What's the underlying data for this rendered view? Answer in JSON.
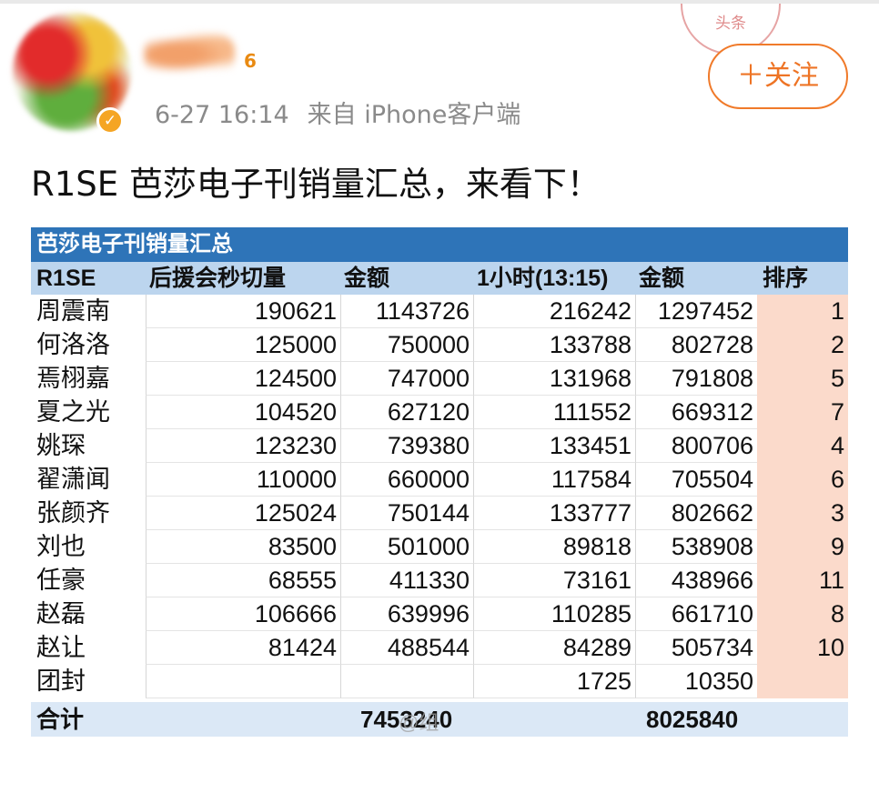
{
  "post": {
    "time": "6-27 16:14",
    "source": "来自 iPhone客户端",
    "follow_label": "＋关注",
    "badge_icon": "verified-badge-icon",
    "level_icon": "level-6-icon",
    "level_text": "6",
    "stamp_text": "头条",
    "text": "R1SE 芭莎电子刊销量汇总，来看下！"
  },
  "sheet": {
    "title": "芭莎电子刊销量汇总",
    "headers": [
      "R1SE",
      "后援会秒切量",
      "金额",
      "1小时(13:15)",
      "金额",
      "排序"
    ],
    "rows": [
      {
        "name": "周震南",
        "v1": "190621",
        "v2": "1143726",
        "v3": "216242",
        "v4": "1297452",
        "rank": "1"
      },
      {
        "name": "何洛洛",
        "v1": "125000",
        "v2": "750000",
        "v3": "133788",
        "v4": "802728",
        "rank": "2"
      },
      {
        "name": "焉栩嘉",
        "v1": "124500",
        "v2": "747000",
        "v3": "131968",
        "v4": "791808",
        "rank": "5"
      },
      {
        "name": "夏之光",
        "v1": "104520",
        "v2": "627120",
        "v3": "111552",
        "v4": "669312",
        "rank": "7"
      },
      {
        "name": "姚琛",
        "v1": "123230",
        "v2": "739380",
        "v3": "133451",
        "v4": "800706",
        "rank": "4"
      },
      {
        "name": "翟潇闻",
        "v1": "110000",
        "v2": "660000",
        "v3": "117584",
        "v4": "705504",
        "rank": "6"
      },
      {
        "name": "张颜齐",
        "v1": "125024",
        "v2": "750144",
        "v3": "133777",
        "v4": "802662",
        "rank": "3"
      },
      {
        "name": "刘也",
        "v1": "83500",
        "v2": "501000",
        "v3": "89818",
        "v4": "538908",
        "rank": "9"
      },
      {
        "name": "任豪",
        "v1": "68555",
        "v2": "411330",
        "v3": "73161",
        "v4": "438966",
        "rank": "11"
      },
      {
        "name": "赵磊",
        "v1": "106666",
        "v2": "639996",
        "v3": "110285",
        "v4": "661710",
        "rank": "8"
      },
      {
        "name": "赵让",
        "v1": "81424",
        "v2": "488544",
        "v3": "84289",
        "v4": "505734",
        "rank": "10"
      },
      {
        "name": "团封",
        "v1": "",
        "v2": "",
        "v3": "1725",
        "v4": "10350",
        "rank": ""
      }
    ],
    "total_label": "合计",
    "total_v2": "7453240",
    "total_v4": "8025840",
    "watermark": "@组"
  },
  "colors": {
    "accent_orange": "#ee7425",
    "sheet_title_blue": "#2e74b8",
    "header_blue": "#bcd5ee",
    "rank_peach": "#fbdacb",
    "total_row": "#dbe8f6"
  }
}
